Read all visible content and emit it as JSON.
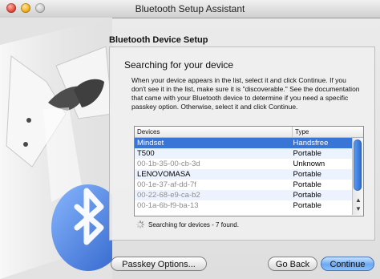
{
  "window": {
    "title": "Bluetooth Setup Assistant"
  },
  "page": {
    "heading": "Bluetooth Device Setup",
    "subtitle": "Searching for your device",
    "description": "When your device appears in the list, select it and click Continue. If you don't see it in the list, make sure it is \"discoverable.\" See the documentation that came with your Bluetooth device to determine if you need a specific passkey option. Otherwise, select it and click Continue."
  },
  "device_list": {
    "columns": [
      "Devices",
      "Type"
    ],
    "rows": [
      {
        "device": "Mindset",
        "type": "Handsfree",
        "selected": true,
        "dim": false
      },
      {
        "device": "T500",
        "type": "Portable",
        "selected": false,
        "dim": false
      },
      {
        "device": "00-1b-35-00-cb-3d",
        "type": "Unknown",
        "selected": false,
        "dim": true
      },
      {
        "device": "LENOVOMASA",
        "type": "Portable",
        "selected": false,
        "dim": false
      },
      {
        "device": "00-1e-37-af-dd-7f",
        "type": "Portable",
        "selected": false,
        "dim": true
      },
      {
        "device": "00-22-68-e9-ca-b2",
        "type": "Portable",
        "selected": false,
        "dim": true
      },
      {
        "device": "00-1a-6b-f9-ba-13",
        "type": "Portable",
        "selected": false,
        "dim": true
      }
    ]
  },
  "status": {
    "text": "Searching for devices - 7 found."
  },
  "buttons": {
    "passkey": "Passkey Options...",
    "back": "Go Back",
    "continue": "Continue"
  },
  "colors": {
    "selection": "#3875d7",
    "bluetooth_logo": "#2a6fe0",
    "primary_button": "#6ba9f2"
  },
  "icons": [
    "close-icon",
    "minimize-icon",
    "zoom-icon",
    "spinner-icon",
    "bluetooth-logo-icon",
    "tuxedo-illustration-icon"
  ]
}
